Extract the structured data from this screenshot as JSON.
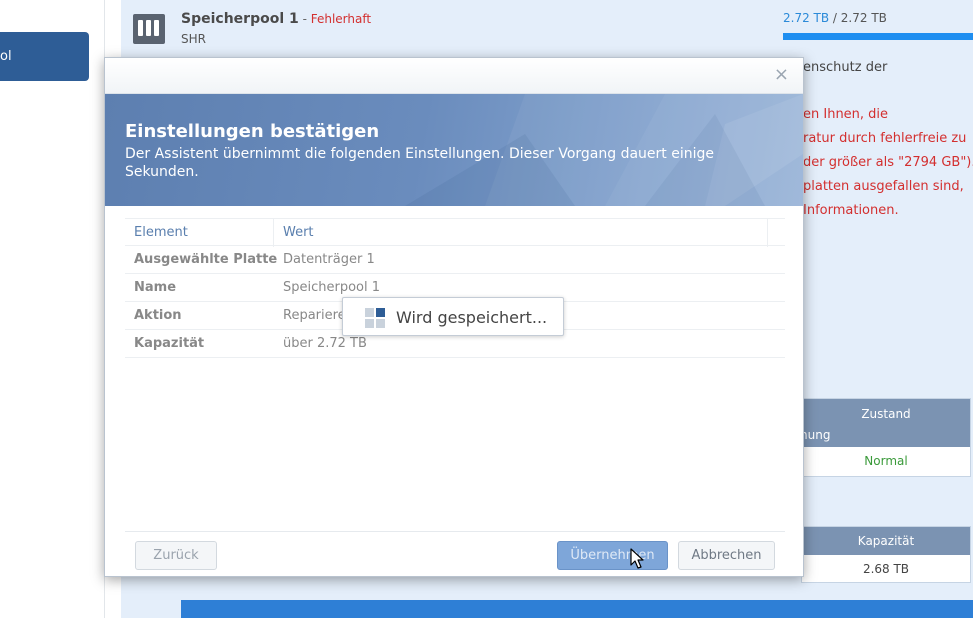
{
  "sidebar": {
    "active_item_label": "ol"
  },
  "pool": {
    "name": "Speicherpool 1",
    "separator": " - ",
    "status": "Fehlerhaft",
    "type": "SHR",
    "capacity_used": "2.72 TB",
    "capacity_sep": " / ",
    "capacity_total": "2.72 TB",
    "capacity_fraction": 1.0,
    "icons": {
      "pool": "storage-pool-icon",
      "warning": "warning-icon"
    }
  },
  "background_text": {
    "line1": "enschutz der",
    "red_lines": [
      "en Ihnen, die",
      "ratur durch fehlerfreie zu",
      "der größer als \"2794 GB\").",
      "platten ausgefallen sind,",
      " Informationen."
    ]
  },
  "background_table1": {
    "header": "Zustand",
    "subheader": "nung",
    "value": "Normal"
  },
  "background_table2": {
    "header": "Kapazität",
    "value": "2.68 TB"
  },
  "dialog": {
    "close_symbol": "×",
    "title": "Einstellungen bestätigen",
    "subtitle": "Der Assistent übernimmt die folgenden Einstellungen. Dieser Vorgang dauert einige Sekunden.",
    "columns": {
      "element": "Element",
      "value": "Wert"
    },
    "rows": [
      {
        "label": "Ausgewählte Platte",
        "value": "Datenträger 1"
      },
      {
        "label": "Name",
        "value": "Speicherpool 1"
      },
      {
        "label": "Aktion",
        "value": "Repariere"
      },
      {
        "label": "Kapazität",
        "value": "über 2.72 TB"
      }
    ],
    "buttons": {
      "back": "Zurück",
      "apply": "Übernehmen",
      "cancel": "Abbrechen"
    }
  },
  "saving": {
    "text": "Wird gespeichert..."
  },
  "colors": {
    "accent": "#2e5d96",
    "error": "#d32f2f",
    "ok": "#3a9a3a",
    "banner": "#6a8cbd"
  }
}
